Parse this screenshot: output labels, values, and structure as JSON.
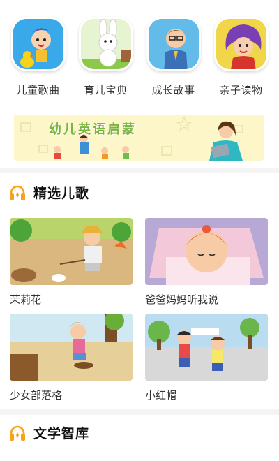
{
  "categories": [
    {
      "label": "儿童歌曲",
      "icon": "singing-child-icon"
    },
    {
      "label": "育儿宝典",
      "icon": "rabbit-icon"
    },
    {
      "label": "成长故事",
      "icon": "teacher-icon"
    },
    {
      "label": "亲子读物",
      "icon": "reading-girl-icon"
    }
  ],
  "banner": {
    "title": "幼儿英语启蒙"
  },
  "sections": [
    {
      "title": "精选儿歌",
      "icon": "headphones-icon",
      "items": [
        {
          "caption": "茉莉花"
        },
        {
          "caption": "爸爸妈妈听我说"
        },
        {
          "caption": "少女部落格"
        },
        {
          "caption": "小红帽"
        }
      ]
    },
    {
      "title": "文学智库",
      "icon": "headphones-icon"
    }
  ],
  "colors": {
    "accent": "#f7a21b",
    "banner_bg": "#fcf6c8",
    "banner_text": "#7ab542"
  }
}
